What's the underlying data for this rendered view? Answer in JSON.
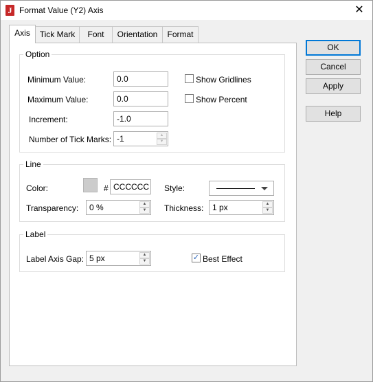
{
  "window": {
    "title": "Format Value (Y2) Axis",
    "icon_letter": "J",
    "close_glyph": "✕"
  },
  "tabs": [
    {
      "label": "Axis",
      "active": true
    },
    {
      "label": "Tick Mark"
    },
    {
      "label": "Font"
    },
    {
      "label": "Orientation"
    },
    {
      "label": "Format"
    }
  ],
  "option": {
    "legend": "Option",
    "min_label": "Minimum Value:",
    "min_value": "0.0",
    "max_label": "Maximum Value:",
    "max_value": "0.0",
    "inc_label": "Increment:",
    "inc_value": "-1.0",
    "ticks_label": "Number of Tick Marks:",
    "ticks_value": "-1",
    "gridlines_label": "Show Gridlines",
    "gridlines_checked": false,
    "percent_label": "Show Percent",
    "percent_checked": false
  },
  "line": {
    "legend": "Line",
    "color_label": "Color:",
    "color_swatch": "#cccccc",
    "hash": "#",
    "color_value": "CCCCCC",
    "style_label": "Style:",
    "transparency_label": "Transparency:",
    "transparency_value": "0 %",
    "thickness_label": "Thickness:",
    "thickness_value": "1 px"
  },
  "label": {
    "legend": "Label",
    "gap_label": "Label Axis Gap:",
    "gap_value": "5 px",
    "best_effect_label": "Best Effect",
    "best_effect_checked": true,
    "check_glyph": "✓"
  },
  "buttons": {
    "ok": "OK",
    "cancel": "Cancel",
    "apply": "Apply",
    "help": "Help"
  },
  "spin_glyphs": {
    "up": "▲",
    "down": "▼"
  },
  "colors": {
    "accent": "#0078d7",
    "check": "#1e5bb5",
    "app_icon": "#c62828"
  }
}
